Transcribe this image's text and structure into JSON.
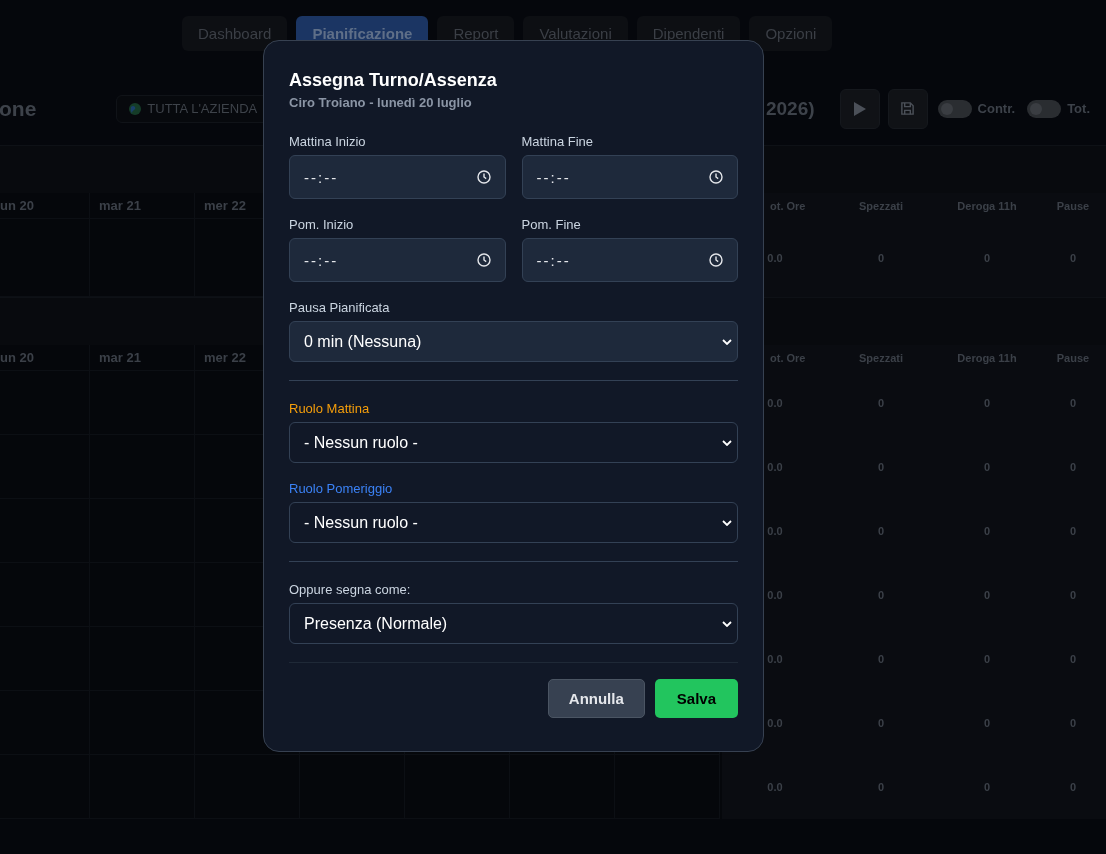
{
  "nav_tabs": [
    {
      "label": "Dashboard",
      "selected": false
    },
    {
      "label": "Pianificazione",
      "selected": true
    },
    {
      "label": "Report",
      "selected": false
    },
    {
      "label": "Valutazioni",
      "selected": false
    },
    {
      "label": "Dipendenti",
      "selected": false
    },
    {
      "label": "Opzioni",
      "selected": false
    }
  ],
  "header": {
    "title_fragment": "one",
    "scope_filter": "TUTTA L'AZIENDA",
    "period_fragment": "2026)",
    "toggles": [
      {
        "label": "Contr.",
        "on": false
      },
      {
        "label": "Tot.",
        "on": false
      }
    ]
  },
  "sections": [
    {
      "day_columns": [
        "un 20",
        "mar 21",
        "mer 22"
      ],
      "summary_columns": [
        "ot. Ore",
        "Spezzati",
        "Deroga 11h",
        "Pause"
      ],
      "rows": [
        [
          "0.0",
          "0",
          "0",
          "0"
        ]
      ]
    },
    {
      "day_columns": [
        "un 20",
        "mar 21",
        "mer 22"
      ],
      "summary_columns": [
        "ot. Ore",
        "Spezzati",
        "Deroga 11h",
        "Pause"
      ],
      "rows": [
        [
          "0.0",
          "0",
          "0",
          "0"
        ],
        [
          "0.0",
          "0",
          "0",
          "0"
        ],
        [
          "0.0",
          "0",
          "0",
          "0"
        ],
        [
          "0.0",
          "0",
          "0",
          "0"
        ],
        [
          "0.0",
          "0",
          "0",
          "0"
        ],
        [
          "0.0",
          "0",
          "0",
          "0"
        ],
        [
          "0.0",
          "0",
          "0",
          "0"
        ]
      ]
    }
  ],
  "modal": {
    "title": "Assegna Turno/Assenza",
    "subtitle": "Ciro Troiano - lunedì 20 luglio",
    "time_fields": [
      {
        "label": "Mattina Inizio",
        "placeholder": "--:--"
      },
      {
        "label": "Mattina Fine",
        "placeholder": "--:--"
      },
      {
        "label": "Pom. Inizio",
        "placeholder": "--:--"
      },
      {
        "label": "Pom. Fine",
        "placeholder": "--:--"
      }
    ],
    "pause": {
      "label": "Pausa Pianificata",
      "value": "0 min (Nessuna)"
    },
    "roles": [
      {
        "label": "Ruolo Mattina",
        "value": "- Nessun ruolo -",
        "color": "#f59e0b"
      },
      {
        "label": "Ruolo Pomeriggio",
        "value": "- Nessun ruolo -",
        "color": "#3b82f6"
      }
    ],
    "status": {
      "label": "Oppure segna come:",
      "value": "Presenza (Normale)"
    },
    "buttons": [
      {
        "label": "Annulla",
        "kind": "secondary"
      },
      {
        "label": "Salva",
        "kind": "primary"
      }
    ]
  }
}
